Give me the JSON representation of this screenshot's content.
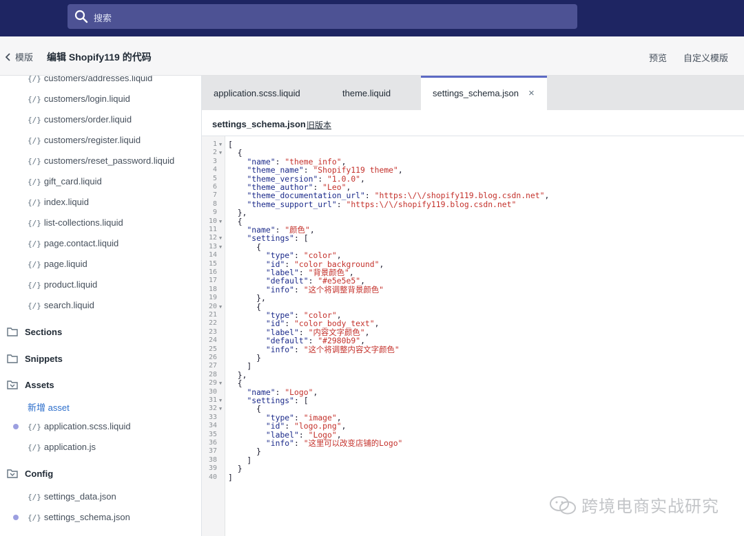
{
  "search": {
    "placeholder": "搜索"
  },
  "subbar": {
    "back_label": "模版",
    "title": "编辑 Shopify119 的代码",
    "preview_label": "预览",
    "customize_label": "自定义模版"
  },
  "sidebar": {
    "templates": [
      "customers/addresses.liquid",
      "customers/login.liquid",
      "customers/order.liquid",
      "customers/register.liquid",
      "customers/reset_password.liquid",
      "gift_card.liquid",
      "index.liquid",
      "list-collections.liquid",
      "page.contact.liquid",
      "page.liquid",
      "product.liquid",
      "search.liquid"
    ],
    "sections_label": "Sections",
    "snippets_label": "Snippets",
    "assets_label": "Assets",
    "add_asset_label": "新增 asset",
    "assets": [
      "application.scss.liquid",
      "application.js"
    ],
    "config_label": "Config",
    "config": [
      "settings_data.json",
      "settings_schema.json"
    ],
    "file_icon_text": "{/}"
  },
  "tabs": [
    {
      "label": "application.scss.liquid"
    },
    {
      "label": "theme.liquid"
    },
    {
      "label": "settings_schema.json"
    }
  ],
  "tab_close": "×",
  "file_header": {
    "name": "settings_schema.json",
    "old_versions": "旧版本"
  },
  "code_lines": [
    "[",
    "  {",
    "    \"name\": \"theme_info\",",
    "    \"theme_name\": \"Shopify119 theme\",",
    "    \"theme_version\": \"1.0.0\",",
    "    \"theme_author\": \"Leo\",",
    "    \"theme_documentation_url\": \"https:\\/\\/shopify119.blog.csdn.net\",",
    "    \"theme_support_url\": \"https:\\/\\/shopify119.blog.csdn.net\"",
    "  },",
    "  {",
    "    \"name\": \"颜色\",",
    "    \"settings\": [",
    "      {",
    "        \"type\": \"color\",",
    "        \"id\": \"color_background\",",
    "        \"label\": \"背景颜色\",",
    "        \"default\": \"#e5e5e5\",",
    "        \"info\": \"这个将调整背景颜色\"",
    "      },",
    "      {",
    "        \"type\": \"color\",",
    "        \"id\": \"color_body_text\",",
    "        \"label\": \"内容文字颜色\",",
    "        \"default\": \"#2980b9\",",
    "        \"info\": \"这个将调整内容文字颜色\"",
    "      }",
    "    ]",
    "  },",
    "  {",
    "    \"name\": \"Logo\",",
    "    \"settings\": [",
    "      {",
    "        \"type\": \"image\",",
    "        \"id\": \"logo.png\",",
    "        \"label\": \"Logo\",",
    "        \"info\": \"这里可以改变店铺的Logo\"",
    "      }",
    "    ]",
    "  }",
    "]"
  ],
  "fold_lines": [
    1,
    2,
    10,
    12,
    13,
    20,
    29,
    31,
    32
  ],
  "watermark": "跨境电商实战研究",
  "colors": {
    "topbar": "#1e2562",
    "accent": "#5c6ac4",
    "code_key": "#1b2a8a",
    "code_string": "#c4312b"
  }
}
